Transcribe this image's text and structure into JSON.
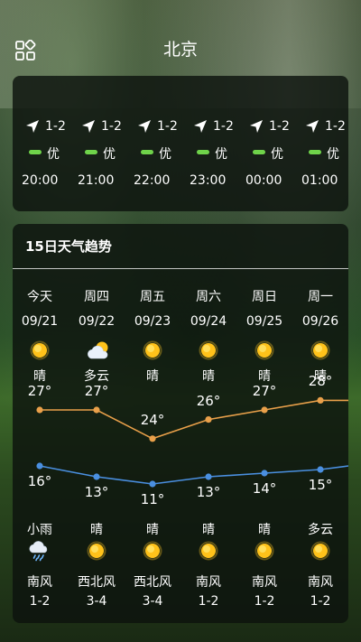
{
  "header": {
    "city": "北京"
  },
  "hourly": [
    {
      "wind": "1-2",
      "aqi": "优",
      "time": "20:00"
    },
    {
      "wind": "1-2",
      "aqi": "优",
      "time": "21:00"
    },
    {
      "wind": "1-2",
      "aqi": "优",
      "time": "22:00"
    },
    {
      "wind": "1-2",
      "aqi": "优",
      "time": "23:00"
    },
    {
      "wind": "1-2",
      "aqi": "优",
      "time": "00:00"
    },
    {
      "wind": "1-2",
      "aqi": "优",
      "time": "01:00"
    }
  ],
  "trend": {
    "title": "15日天气趋势",
    "days": [
      {
        "name": "今天",
        "date": "09/21",
        "day_icon": "sun-icon",
        "day_weather": "晴",
        "high": 27,
        "low": 16,
        "night_weather": "小雨",
        "night_icon": "light-rain-icon",
        "wind_dir": "南风",
        "wind_level": "1-2"
      },
      {
        "name": "周四",
        "date": "09/22",
        "day_icon": "partly-cloudy-icon",
        "day_weather": "多云",
        "high": 27,
        "low": 13,
        "night_weather": "晴",
        "night_icon": "sun-icon",
        "wind_dir": "西北风",
        "wind_level": "3-4"
      },
      {
        "name": "周五",
        "date": "09/23",
        "day_icon": "sun-icon",
        "day_weather": "晴",
        "high": 24,
        "low": 11,
        "night_weather": "晴",
        "night_icon": "sun-icon",
        "wind_dir": "西北风",
        "wind_level": "3-4"
      },
      {
        "name": "周六",
        "date": "09/24",
        "day_icon": "sun-icon",
        "day_weather": "晴",
        "high": 26,
        "low": 13,
        "night_weather": "晴",
        "night_icon": "sun-icon",
        "wind_dir": "南风",
        "wind_level": "1-2"
      },
      {
        "name": "周日",
        "date": "09/25",
        "day_icon": "sun-icon",
        "day_weather": "晴",
        "high": 27,
        "low": 14,
        "night_weather": "晴",
        "night_icon": "sun-icon",
        "wind_dir": "南风",
        "wind_level": "1-2"
      },
      {
        "name": "周一",
        "date": "09/26",
        "day_icon": "sun-icon",
        "day_weather": "晴",
        "high": 28,
        "low": 15,
        "night_weather": "多云",
        "night_icon": "cloud-icon",
        "wind_dir": "南风",
        "wind_level": "1-2"
      }
    ],
    "units": {
      "degree": "°"
    }
  },
  "colors": {
    "high_line": "#e9a04a",
    "low_line": "#4a8fe0",
    "aqi_good": "#6fd34a",
    "sun": "#ffc21a"
  }
}
